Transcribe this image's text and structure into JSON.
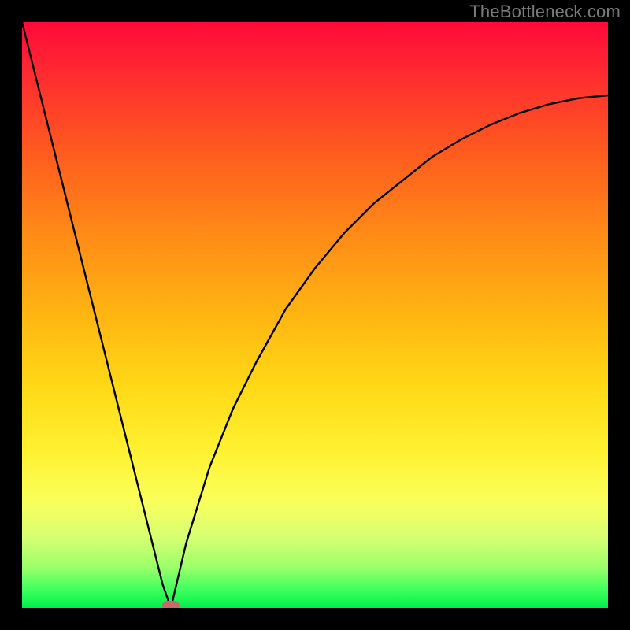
{
  "watermark": "TheBottleneck.com",
  "colors": {
    "gradient_top": "#ff0a3a",
    "gradient_bottom": "#00ef4b",
    "curve": "#000000",
    "marker": "#c86a6a",
    "frame": "#000000"
  },
  "chart_data": {
    "type": "line",
    "title": "",
    "xlabel": "",
    "ylabel": "",
    "xlim": [
      0,
      100
    ],
    "ylim": [
      0,
      100
    ],
    "grid": false,
    "legend": false,
    "annotations": [
      "TheBottleneck.com"
    ],
    "series": [
      {
        "name": "left-branch",
        "x": [
          0,
          2,
          4,
          6,
          8,
          10,
          12,
          14,
          16,
          18,
          20,
          22,
          24,
          25.4
        ],
        "y": [
          100,
          92,
          84,
          76,
          68,
          60,
          52,
          44,
          36,
          28,
          20,
          12,
          4,
          0
        ]
      },
      {
        "name": "right-branch",
        "x": [
          25.4,
          28,
          32,
          36,
          40,
          45,
          50,
          55,
          60,
          65,
          70,
          75,
          80,
          85,
          90,
          95,
          100
        ],
        "y": [
          0,
          11,
          24,
          34,
          42,
          51,
          58,
          64,
          69,
          73,
          77,
          80,
          82.5,
          84.5,
          86,
          87,
          87.5
        ]
      }
    ],
    "minimum_point": {
      "x": 25.4,
      "y": 0
    }
  }
}
